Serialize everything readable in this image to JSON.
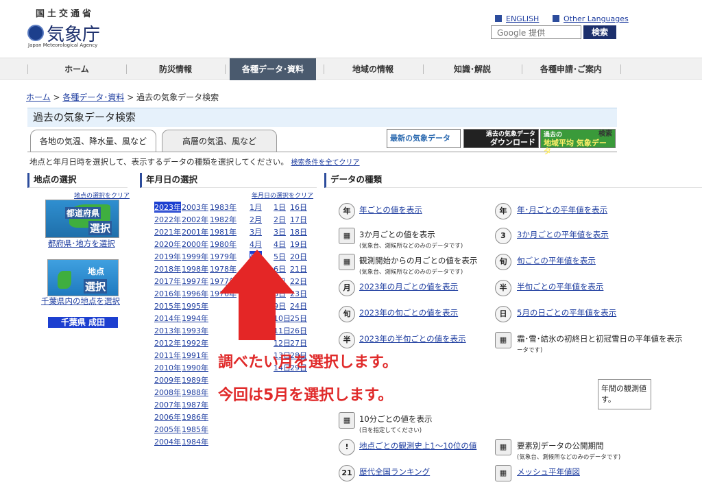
{
  "header": {
    "agency_kanji": "国土交通省",
    "agency_name": "気象庁",
    "agency_en": "Japan Meteorological Agency",
    "lang_english": "ENGLISH",
    "lang_other": "Other Languages",
    "search_placeholder": "Google 提供",
    "search_button": "検索"
  },
  "nav": {
    "items": [
      "ホーム",
      "防災情報",
      "各種データ･資料",
      "地域の情報",
      "知識･解説",
      "各種申請･ご案内"
    ],
    "active_index": 2
  },
  "breadcrumb": {
    "home": "ホーム",
    "data": "各種データ･資料",
    "current": "過去の気象データ検索",
    "sep": ">"
  },
  "page_title": "過去の気象データ検索",
  "tabs": [
    "各地の気温、降水量、風など",
    "高層の気温、風など"
  ],
  "banners": {
    "latest": "最新の気象データ",
    "download_top": "過去の気象データ",
    "download_bottom": "ダウンロード",
    "regional_top": "過去の",
    "regional_bottom": "地域平均 気象データ",
    "regional_search": "検索"
  },
  "instruction": "地点と年月日時を選択して、表示するデータの種類を選択してください。",
  "clear_all": "検索条件を全てクリア",
  "location": {
    "header": "地点の選択",
    "clear": "地点の選択をクリア",
    "pref_title": "都道府県",
    "pref_select": "選択",
    "pref_link": "都府県･地方を選択",
    "point_title": "地点",
    "point_select": "選択",
    "point_link": "千葉県内の地点を選択",
    "selected": "千葉県 成田"
  },
  "date": {
    "header": "年月日の選択",
    "clear": "年月日の選択をクリア",
    "years_col1": [
      "2023年",
      "2022年",
      "2021年",
      "2020年",
      "2019年",
      "2018年",
      "2017年",
      "2016年",
      "2015年",
      "2014年",
      "2013年",
      "2012年",
      "2011年",
      "2010年",
      "2009年",
      "2008年",
      "2007年",
      "2006年",
      "2005年",
      "2004年"
    ],
    "years_col2": [
      "2003年",
      "2002年",
      "2001年",
      "2000年",
      "1999年",
      "1998年",
      "1997年",
      "1996年",
      "1995年",
      "1994年",
      "1993年",
      "1992年",
      "1991年",
      "1990年",
      "1989年",
      "1988年",
      "1987年",
      "1986年",
      "1985年",
      "1984年"
    ],
    "years_col3": [
      "1983年",
      "1982年",
      "1981年",
      "1980年",
      "1979年",
      "1978年",
      "1977年",
      "1976年"
    ],
    "months": [
      "1月",
      "2月",
      "3月",
      "4月",
      "5月"
    ],
    "days_col1": [
      "1日",
      "2日",
      "3日",
      "4日",
      "5日",
      "6日",
      "7日",
      "8日",
      "9日",
      "10日",
      "11日",
      "12日",
      "13日",
      "14日"
    ],
    "days_col2": [
      "16日",
      "17日",
      "18日",
      "19日",
      "20日",
      "21日",
      "22日",
      "23日",
      "24日",
      "25日",
      "26日",
      "27日",
      "28日",
      "29日"
    ],
    "selected_year": "2023年",
    "selected_month": "5月"
  },
  "dtype": {
    "header": "データの種類",
    "left": [
      {
        "icon": "年",
        "label": "年ごとの値を表示",
        "link": true,
        "sub": ""
      },
      {
        "icon": "",
        "label": "3か月ごとの値を表示",
        "link": false,
        "sub": "(気象台、測候所などのみのデータです)"
      },
      {
        "icon": "",
        "label": "観測開始からの月ごとの値を表示",
        "link": false,
        "sub": "(気象台、測候所などのみのデータです)"
      },
      {
        "icon": "月",
        "label": "2023年の月ごとの値を表示",
        "link": true,
        "sub": ""
      },
      {
        "icon": "旬",
        "label": "2023年の旬ごとの値を表示",
        "link": true,
        "sub": ""
      },
      {
        "icon": "半",
        "label": "2023年の半旬ごとの値を表示",
        "link": true,
        "sub": ""
      },
      {
        "icon": "",
        "label": "10分ごとの値を表示",
        "link": false,
        "sub": "(日を指定してください)"
      },
      {
        "icon": "!",
        "label": "地点ごとの観測史上1～10位の値",
        "link": true,
        "sub": ""
      },
      {
        "icon": "21",
        "label": "歴代全国ランキング",
        "link": true,
        "sub": ""
      }
    ],
    "right": [
      {
        "icon": "年",
        "label": "年･月ごとの平年値を表示",
        "link": true,
        "sub": ""
      },
      {
        "icon": "3",
        "label": "3か月ごとの平年値を表示",
        "link": true,
        "sub": ""
      },
      {
        "icon": "旬",
        "label": "旬ごとの平年値を表示",
        "link": true,
        "sub": ""
      },
      {
        "icon": "半",
        "label": "半旬ごとの平年値を表示",
        "link": true,
        "sub": ""
      },
      {
        "icon": "日",
        "label": "5月の日ごとの平年値を表示",
        "link": true,
        "sub": ""
      },
      {
        "icon": "",
        "label": "霜･雪･結氷の初終日と初冠雪日の平年値を表示",
        "link": false,
        "sub": "ータです)"
      },
      {
        "icon": "",
        "label": "要素別データの公開期間",
        "link": false,
        "sub": "(気象台、測候所などのみのデータです)"
      },
      {
        "icon": "",
        "label": "メッシュ平年値図",
        "link": true,
        "sub": ""
      }
    ],
    "callout_line1": "年間の観測値",
    "callout_line2": "す。"
  },
  "annotation": {
    "line1": "調べたい月を選択します。",
    "line2": "今回は5月を選択します。",
    "color": "#e02a2a"
  }
}
